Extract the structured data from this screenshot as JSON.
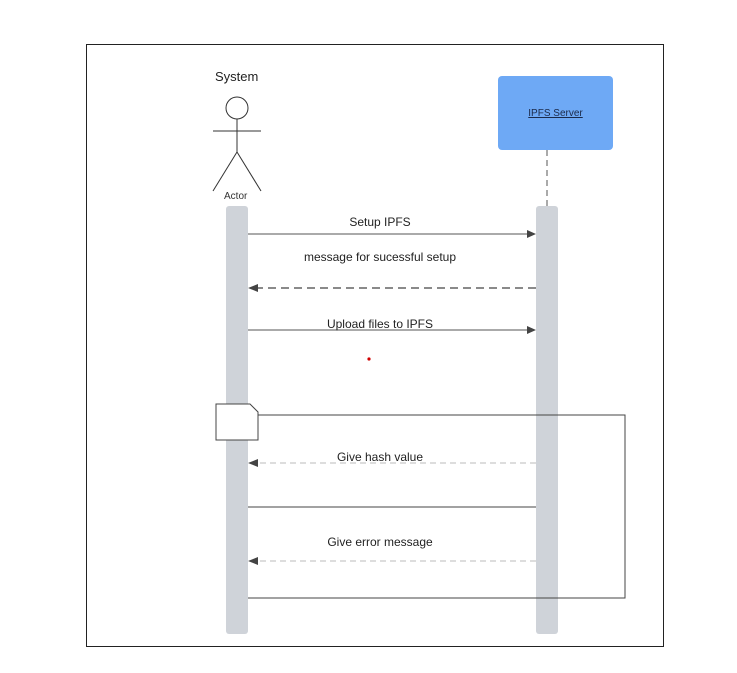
{
  "diagram": {
    "system_title": "System",
    "actor_label": "Actor",
    "server_label": "IPFS Server",
    "messages": [
      "Setup IPFS",
      "message for sucessful setup",
      "Upload files to IPFS",
      "Give hash value",
      "Give error message"
    ]
  },
  "colors": {
    "server_fill": "#6ea9f5",
    "lifeline": "#cfd3d9",
    "line": "#555555",
    "marker": "#d00000"
  }
}
